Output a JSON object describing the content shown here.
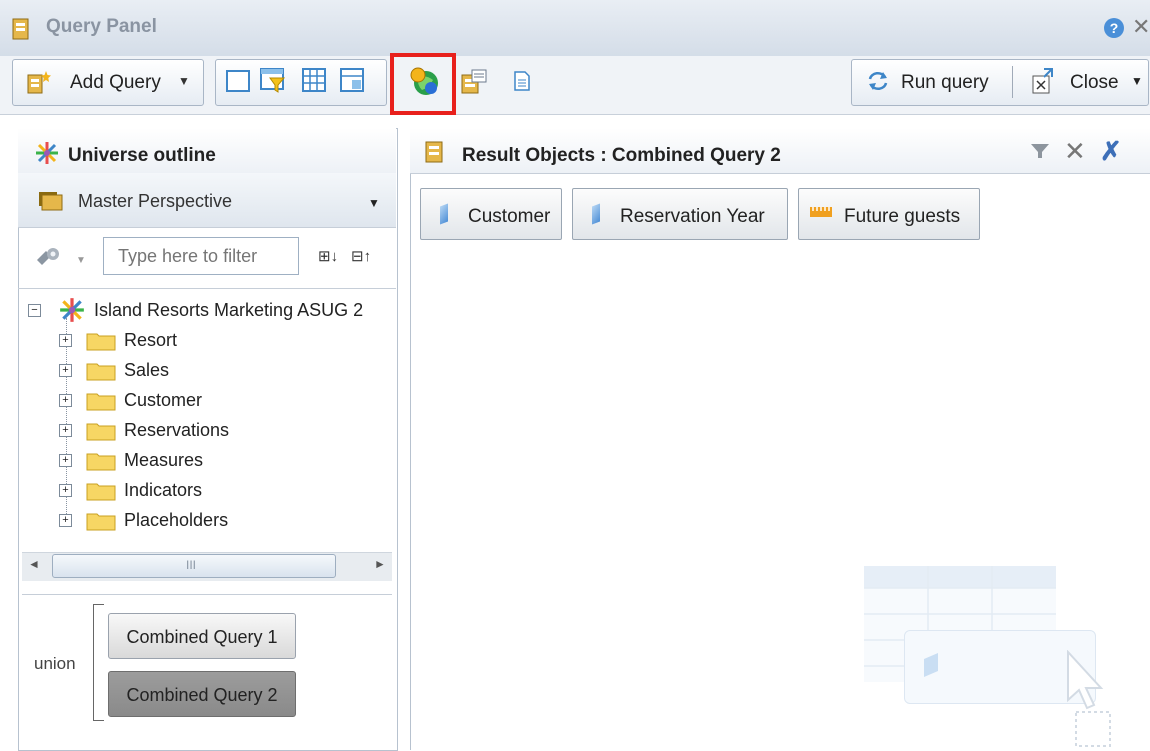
{
  "window": {
    "title": "Query Panel",
    "help_glyph": "?",
    "close_glyph": "✕"
  },
  "toolbar": {
    "add_query_label": "Add Query",
    "run_query_label": "Run query",
    "close_label": "Close",
    "caret": "▼",
    "highlighted_button": "combined-query-globe-icon",
    "highlight_color": "#e8201c"
  },
  "universe_outline": {
    "title": "Universe outline",
    "perspective": "Master Perspective",
    "filter_placeholder": "Type here to filter",
    "root_label": "Island Resorts Marketing ASUG 2",
    "folders": [
      "Resort",
      "Sales",
      "Customer",
      "Reservations",
      "Measures",
      "Indicators",
      "Placeholders"
    ],
    "scroll_grip": "III"
  },
  "combined_queries": {
    "operator": "union",
    "queries": [
      "Combined Query 1",
      "Combined Query 2"
    ],
    "selected_index": 1
  },
  "result_objects": {
    "title": "Result Objects : Combined Query 2",
    "items": [
      {
        "label": "Customer",
        "kind": "dimension"
      },
      {
        "label": "Reservation Year",
        "kind": "dimension"
      },
      {
        "label": "Future guests",
        "kind": "measure"
      }
    ]
  },
  "colors": {
    "dimension_blue": "#4d8ed6",
    "measure_orange": "#f0a020",
    "folder_yellow": "#f7d664"
  }
}
